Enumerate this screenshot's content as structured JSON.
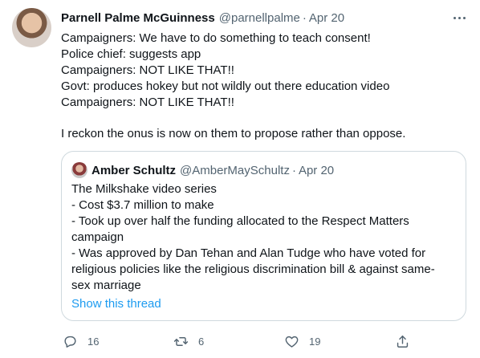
{
  "tweet": {
    "author_name": "Parnell Palme McGuinness",
    "handle": "@parnellpalme",
    "separator": "·",
    "time": "Apr 20",
    "lines": [
      "Campaigners: We have to do something to teach consent!",
      "Police chief: suggests app",
      "Campaigners: NOT LIKE THAT!!",
      "Govt: produces hokey but not wildly out there education video",
      "Campaigners: NOT LIKE THAT!!"
    ],
    "closing_line": "I reckon the onus is now on them to propose rather than oppose."
  },
  "quote": {
    "author_name": "Amber Schultz",
    "handle": "@AmberMaySchultz",
    "separator": "·",
    "time": "Apr 20",
    "lines": [
      "The Milkshake video series",
      "- Cost $3.7 million to make",
      "- Took up over half the funding allocated to the Respect Matters",
      "campaign",
      "- Was approved by Dan Tehan and Alan Tudge who have voted for",
      "religious policies like the religious discrimination bill & against same-",
      "sex marriage"
    ],
    "show_thread": "Show this thread"
  },
  "actions": {
    "replies": "16",
    "retweets": "6",
    "likes": "19"
  },
  "icons": {
    "more": "more-horizontal-icon",
    "reply": "reply-bubble-icon",
    "retweet": "retweet-arrows-icon",
    "like": "heart-icon",
    "share": "share-upload-icon"
  },
  "colors": {
    "text": "#0f1419",
    "secondary": "#536471",
    "link": "#1d9bf0",
    "border": "#cfd9de"
  }
}
